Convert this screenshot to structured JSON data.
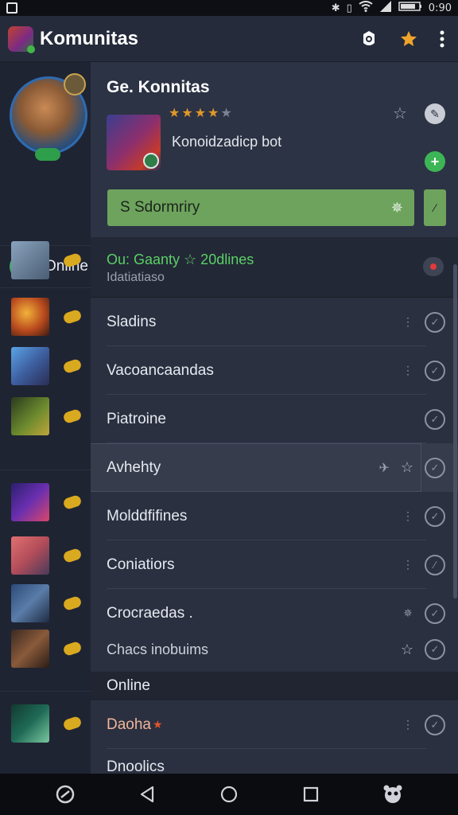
{
  "status_bar": {
    "time": "0:90"
  },
  "app_bar": {
    "title": "Komunitas"
  },
  "rail": {
    "online_label": "Online",
    "items": [
      {
        "thumb_color": "#6e8aa8"
      },
      {
        "thumb_color": "#b8491e"
      },
      {
        "thumb_color": "#3e5fa0"
      },
      {
        "thumb_color": "#4d6a28"
      },
      {
        "thumb_color": "#4a2c8a"
      },
      {
        "thumb_color": "#b34d5a"
      },
      {
        "thumb_color": "#3a5c8c"
      },
      {
        "thumb_color": "#6a4030"
      },
      {
        "thumb_color": "#1f6a56"
      }
    ]
  },
  "header": {
    "title": "Ge. Konnitas",
    "rating": 4,
    "subtitle": "Konoidzadicp bot",
    "cta_label": "S Sdormriry"
  },
  "status_card": {
    "line1": "Ou: Gaanty ☆ 20dlines",
    "line2": "Idatiatiaso"
  },
  "list": [
    {
      "label": "Sladins",
      "selected": false
    },
    {
      "label": "Vacoancaandas",
      "selected": false
    },
    {
      "label": "Piatroine",
      "selected": false
    },
    {
      "label": "Avhehty",
      "selected": true
    },
    {
      "label": "Molddfifines",
      "selected": false
    },
    {
      "label": "Coniatiors",
      "selected": false
    },
    {
      "label": "Crocraedas .",
      "selected": false
    },
    {
      "label": "Chacs inobuims",
      "selected": false
    }
  ],
  "section_online": "Online",
  "online_list": [
    {
      "label": "Daoha"
    },
    {
      "label": "Dnoolics"
    }
  ],
  "colors": {
    "accent_green": "#3db556",
    "cta_green": "#6ea35e",
    "star_orange": "#e0982a",
    "panel_bg": "#2a3040"
  }
}
